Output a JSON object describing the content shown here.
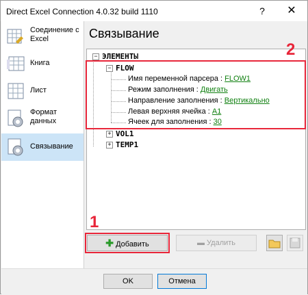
{
  "window": {
    "title": "Direct Excel Connection 4.0.32 build 1110",
    "help": "?",
    "close": "✕"
  },
  "sidebar": {
    "items": [
      {
        "label": "Соединение с Excel",
        "icon": "excel-connection-icon"
      },
      {
        "label": "Книга",
        "icon": "workbook-icon"
      },
      {
        "label": "Лист",
        "icon": "sheet-icon"
      },
      {
        "label": "Формат данных",
        "icon": "data-format-icon"
      },
      {
        "label": "Связывание",
        "icon": "binding-icon",
        "active": true
      }
    ]
  },
  "main": {
    "title": "Связывание",
    "tree": {
      "root": "ЭЛЕМЕНТЫ",
      "flow": {
        "name": "FLOW",
        "props": [
          {
            "label": "Имя переменной парсера : ",
            "value": "FLOW1"
          },
          {
            "label": "Режим заполнения : ",
            "value": "Двигать"
          },
          {
            "label": "Направление заполнения : ",
            "value": "Вертикально"
          },
          {
            "label": "Левая верхняя ячейка : ",
            "value": "A1"
          },
          {
            "label": "Ячеек для заполнения : ",
            "value": "30"
          }
        ]
      },
      "others": [
        "VOL1",
        "TEMP1"
      ]
    },
    "add_button": "Добавить",
    "delete_button": "Удалить"
  },
  "footer": {
    "ok": "OK",
    "cancel": "Отмена"
  },
  "annotations": {
    "one": "1",
    "two": "2",
    "color": "#e8263a"
  }
}
